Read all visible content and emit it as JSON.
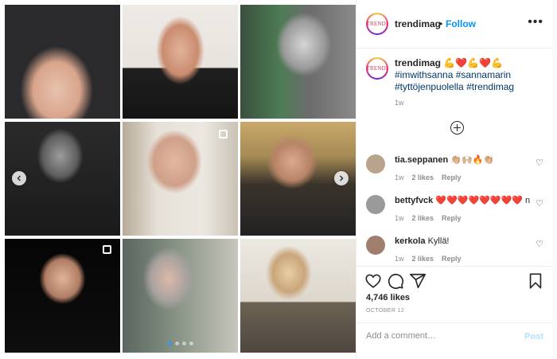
{
  "media": {
    "tiles": [
      "photo",
      "photo",
      "photo",
      "photo",
      "photo",
      "photo",
      "photo",
      "photo",
      "photo"
    ],
    "prev_arrow": "chevron-left-icon",
    "next_arrow": "chevron-right-icon",
    "carousel_dots": 4,
    "carousel_active": 0
  },
  "header": {
    "avatar_text": "TRENDI",
    "username": "trendimag",
    "separator": "•",
    "follow_label": "Follow",
    "more_icon": "more-horizontal-icon"
  },
  "caption": {
    "username": "trendimag",
    "text": "💪❤️💪❤️💪",
    "hashtags": "#imwithsanna #sannamarin #tyttöjenpuolella #trendimag",
    "time": "1w"
  },
  "load_more_icon": "plus-circle-icon",
  "comments": [
    {
      "username": "tia.seppanen",
      "text": "👏🏼🙌🏼🔥👏🏼",
      "time": "1w",
      "likes": "2 likes",
      "reply": "Reply",
      "avatar_color": "#b9a38d"
    },
    {
      "username": "bettyfvck",
      "text": "❤️❤️❤️❤️❤️❤️❤️❤️ naiset",
      "time": "1w",
      "likes": "2 likes",
      "reply": "Reply",
      "avatar_color": "#9a9a9a"
    },
    {
      "username": "kerkola",
      "text": "Kyllä!",
      "time": "1w",
      "likes": "2 likes",
      "reply": "Reply",
      "avatar_color": "#a07f6e"
    }
  ],
  "actions": {
    "like_icon": "heart-icon",
    "comment_icon": "comment-icon",
    "share_icon": "send-icon",
    "save_icon": "bookmark-icon"
  },
  "likes": "4,746 likes",
  "date": "OCTOBER 12",
  "add_comment": {
    "placeholder": "Add a comment…",
    "post_label": "Post"
  },
  "colors": {
    "accent": "#0095f6",
    "post_disabled": "#b2dffc",
    "hashtag": "#00376b",
    "muted": "#8e8e8e"
  }
}
